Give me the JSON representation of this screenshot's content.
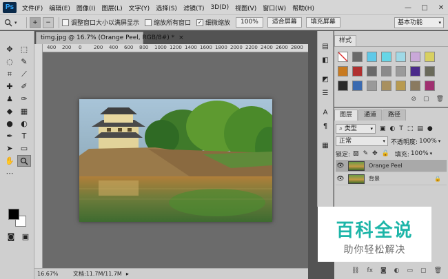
{
  "app": {
    "logo": "Ps"
  },
  "menu": [
    "文件(F)",
    "编辑(E)",
    "图像(I)",
    "图层(L)",
    "文字(Y)",
    "选择(S)",
    "滤镜(T)",
    "3D(D)",
    "视图(V)",
    "窗口(W)",
    "帮助(H)"
  ],
  "window_controls": {
    "minimize": "—",
    "restore": "□",
    "close": "✕"
  },
  "options": {
    "zoom_in": "+",
    "zoom_out": "−",
    "resize_windows": "调整窗口大小以满屏显示",
    "zoom_all": "缩放所有窗口",
    "scrubby": "细微缩放",
    "percent": "100%",
    "fit_screen": "适合屏幕",
    "fill_screen": "填充屏幕",
    "workspace": "基本功能"
  },
  "document": {
    "tab_title": "timg.jpg @ 16.7% (Orange Peel, RGB/8#) *",
    "zoom": "16.67%",
    "doc_info": "文档:11.7M/11.7M"
  },
  "ruler": {
    "ticks": [
      "400",
      "200",
      "0",
      "200",
      "400",
      "600",
      "800",
      "1000",
      "1200",
      "1400",
      "1600",
      "1800",
      "2000",
      "2200",
      "2400",
      "2600",
      "2800"
    ]
  },
  "styles_panel": {
    "tab": "样式",
    "swatches": [
      "#ffffff",
      "#6a6a6a",
      "#5fc9e8",
      "#66d6e6",
      "#9fd9e6",
      "#c9a8d8",
      "#d8d060",
      "#c87a20",
      "#b03030",
      "#6a6a6a",
      "#8a8a8a",
      "#9a9a9a",
      "#4a2a8a",
      "#6a6a5a",
      "#2a2a2a",
      "#3a6ab0",
      "#9a9a9a",
      "#a89060",
      "#b89a50",
      "#8a7a60",
      "#a03070"
    ]
  },
  "layers_panel": {
    "tabs": [
      "图层",
      "通道",
      "路径"
    ],
    "filter": "类型",
    "blend_mode": "正常",
    "opacity_label": "不透明度:",
    "opacity": "100%",
    "lock_label": "锁定:",
    "fill_label": "填充:",
    "fill": "100%",
    "layers": [
      {
        "name": "Orange Peel",
        "active": true
      },
      {
        "name": "背景",
        "active": false
      }
    ]
  },
  "watermark": {
    "title": "百科全说",
    "subtitle": "助你轻松解决"
  }
}
